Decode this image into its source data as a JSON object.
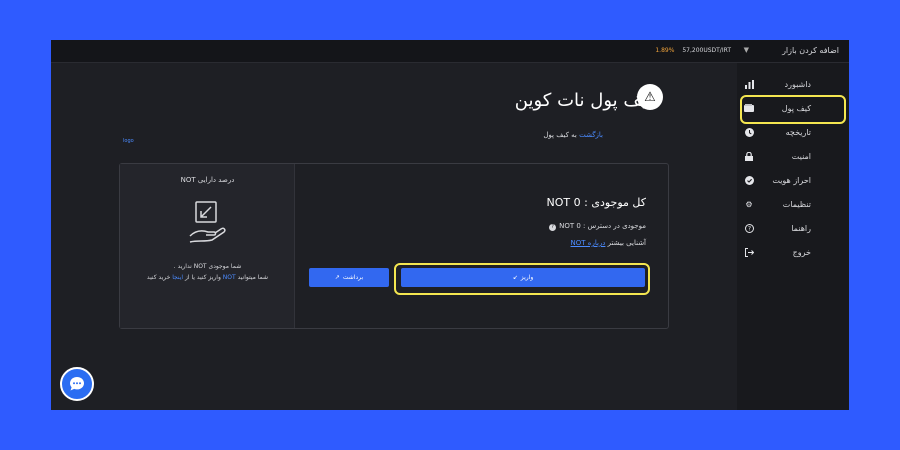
{
  "topbar": {
    "market_add": "اضافه کردن بازار",
    "ticker_pair": "57,200USDT/IRT",
    "ticker_change": "1.89%"
  },
  "sidebar": {
    "items": [
      {
        "label": "داشبورد",
        "icon": "bar-chart-icon"
      },
      {
        "label": "کیف پول",
        "icon": "wallet-icon"
      },
      {
        "label": "تاریخچه",
        "icon": "history-icon"
      },
      {
        "label": "امنیت",
        "icon": "lock-icon"
      },
      {
        "label": "احراز هویت",
        "icon": "check-circle-icon"
      },
      {
        "label": "تنظیمات",
        "icon": "gear-icon"
      },
      {
        "label": "راهنما",
        "icon": "help-icon"
      },
      {
        "label": "خروج",
        "icon": "logout-icon"
      }
    ]
  },
  "main": {
    "title": "کیف پول نات کوین",
    "title_badge": "⚠",
    "back_link": "بازگشت",
    "back_text": "به کیف پول",
    "tiny_logo": "logo",
    "asset_percent_title": "درصد دارایی NOT",
    "no_asset_line1": "شما موجودی NOT ندارید .",
    "no_asset_line2_a": "شما میتوانید",
    "no_asset_line2_not": "NOT",
    "no_asset_line2_b": "واریز کنید یا از",
    "no_asset_line2_here": "اینجا",
    "no_asset_line2_c": "خرید کنید",
    "total_balance": "کل موجودی : 0 NOT",
    "available_balance": "موجودی در دسترس : 0 NOT",
    "learn_more_text": "آشنایی بیشتر",
    "learn_more_link": "درباره NOT",
    "withdraw_label": "برداشت",
    "deposit_label": "واریز"
  },
  "colors": {
    "background": "#2f5bff",
    "panel": "#1e1f24",
    "accent": "#3268f0",
    "highlight": "#f4e650"
  }
}
